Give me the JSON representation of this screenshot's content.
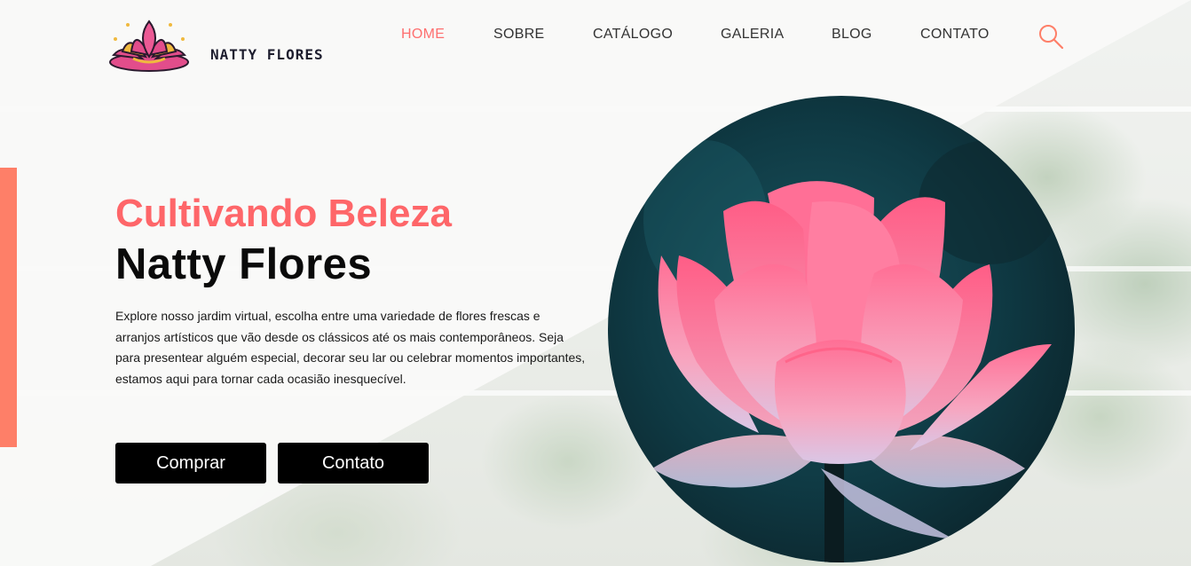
{
  "brand": {
    "name": "NATTY FLORES"
  },
  "nav": {
    "items": [
      {
        "label": "HOME",
        "active": true
      },
      {
        "label": "SOBRE",
        "active": false
      },
      {
        "label": "CATÁLOGO",
        "active": false
      },
      {
        "label": "GALERIA",
        "active": false
      },
      {
        "label": "BLOG",
        "active": false
      },
      {
        "label": "CONTATO",
        "active": false
      }
    ]
  },
  "hero": {
    "subtitle": "Cultivando Beleza",
    "title": "Natty Flores",
    "description": "Explore nosso jardim virtual, escolha entre uma variedade de flores frescas e arranjos artísticos que vão desde os clássicos até os mais contemporâneos. Seja para presentear alguém especial, decorar seu lar ou celebrar momentos importantes, estamos aqui para tornar cada ocasião inesquecível.",
    "buttons": {
      "buy": "Comprar",
      "contact": "Contato"
    }
  },
  "colors": {
    "accent": "#fe6669",
    "side_bar": "#fe7f68",
    "button_bg": "#000000",
    "text_dark": "#0a0a0a"
  },
  "icons": {
    "search": "search-icon",
    "logo": "lotus-logo-icon"
  }
}
